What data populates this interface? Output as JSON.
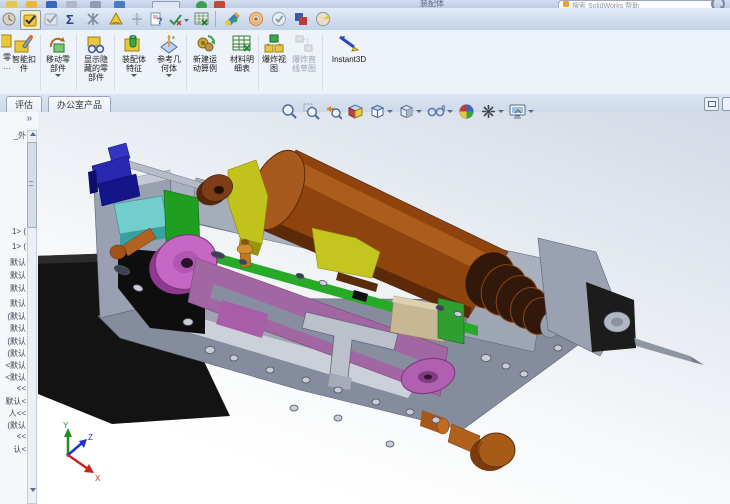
{
  "window": {
    "title_fragment": "装配体",
    "search": {
      "placeholder": "搜索 SolidWorks 帮助"
    }
  },
  "toolbar": {
    "left_icons": [
      "clock",
      "verification-check",
      "check-disabled",
      "equations-sigma",
      "interference-detection",
      "alert-cone",
      "align-tool",
      "help-document",
      "measure",
      "measure-dropdown",
      "design-table"
    ],
    "right_icons": [
      "edit-appearance",
      "motion-rings",
      "check-circle",
      "compare-documents",
      "render-sphere"
    ]
  },
  "ribbon": {
    "buttons": [
      {
        "id": "insert-component-partial",
        "lines": [
          "零",
          "…"
        ]
      },
      {
        "id": "smart-fasteners",
        "lines": [
          "智能扣",
          "件"
        ]
      },
      {
        "id": "move-component",
        "lines": [
          "移动零",
          "部件"
        ],
        "dropdown": true
      },
      {
        "id": "show-hidden-components",
        "lines": [
          "显示隐",
          "藏的零",
          "部件"
        ]
      },
      {
        "id": "assembly-features",
        "lines": [
          "装配体",
          "特征"
        ],
        "dropdown": true
      },
      {
        "id": "reference-geometry",
        "lines": [
          "参考几",
          "何体"
        ],
        "dropdown": true
      },
      {
        "id": "new-motion-study",
        "lines": [
          "新建运",
          "动算例"
        ]
      },
      {
        "id": "bill-of-materials",
        "lines": [
          "材料明",
          "细表"
        ]
      },
      {
        "id": "exploded-view",
        "lines": [
          "爆炸视",
          "图"
        ]
      },
      {
        "id": "explode-line-sketch",
        "lines": [
          "爆炸直",
          "线草图"
        ],
        "disabled": true
      },
      {
        "id": "instant3d",
        "lines": [
          "Instant3D"
        ]
      }
    ]
  },
  "tabs": [
    {
      "label": "评估",
      "active": true
    },
    {
      "label": "办公室产品",
      "active": false
    }
  ],
  "feature_tree": {
    "expand_chevron": "»",
    "items": [
      "_外",
      "1> (",
      "1> (",
      "默认",
      "默认",
      "默认",
      "默认",
      "(默认",
      "默认",
      "(默认",
      "(默认",
      "<默认",
      "<默认",
      "<<",
      "默认<",
      "人<<",
      "(默认",
      "<<",
      "认<"
    ]
  },
  "headsup_toolbar": {
    "icons": [
      "zoom-to-fit",
      "zoom-to-area",
      "previous-view",
      "section-view",
      "view-orientation",
      "display-style",
      "hide-show-items",
      "edit-appearance",
      "apply-scene",
      "view-settings"
    ]
  },
  "triad": {
    "x_label": "X",
    "y_label": "Y",
    "z_label": "Z",
    "x_color": "#cc2222",
    "y_color": "#1e8f1e",
    "z_color": "#2233cc"
  },
  "model_parts": [
    {
      "name": "base-plate",
      "color": "#131313"
    },
    {
      "name": "chassis-frame",
      "color": "#9aa1b2"
    },
    {
      "name": "spindle-motor",
      "color": "#8f440e"
    },
    {
      "name": "motor-bracket",
      "color": "#2828b0"
    },
    {
      "name": "slider-block",
      "color": "#74cdcd"
    },
    {
      "name": "guide-plate",
      "color": "#1f9e1f"
    },
    {
      "name": "drive-belt",
      "color": "#a266a2"
    },
    {
      "name": "pulley",
      "color": "#c667c6"
    },
    {
      "name": "tensioner-bracket",
      "color": "#c2c21c"
    },
    {
      "name": "clamp-block",
      "color": "#c7b795"
    },
    {
      "name": "thumb-bolt",
      "color": "#b0611c"
    },
    {
      "name": "tailstock-bracket",
      "color": "#9aa1b1"
    }
  ]
}
